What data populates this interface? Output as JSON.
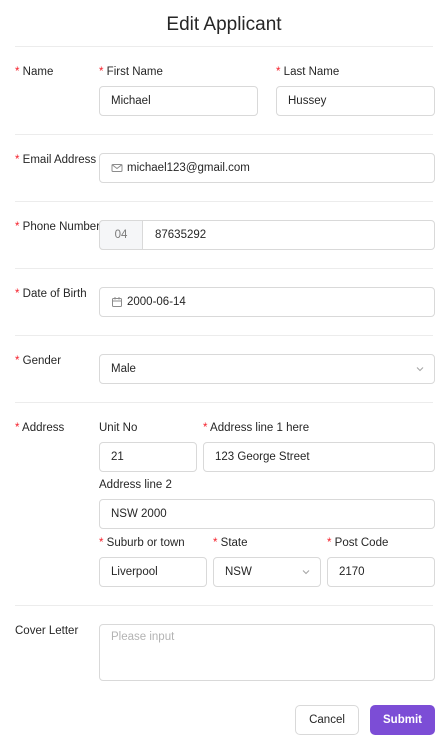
{
  "dialog": {
    "title": "Edit Applicant"
  },
  "name": {
    "label": "Name",
    "first_label": "First Name",
    "first_value": "Michael",
    "last_label": "Last Name",
    "last_value": "Hussey"
  },
  "email": {
    "label": "Email Address",
    "value": "michael123@gmail.com",
    "icon": "mail-icon"
  },
  "phone": {
    "label": "Phone Number",
    "prefix": "04",
    "value": "87635292"
  },
  "dob": {
    "label": "Date of Birth",
    "value": "2000-06-14",
    "icon": "calendar-icon"
  },
  "gender": {
    "label": "Gender",
    "value": "Male"
  },
  "address": {
    "label": "Address",
    "unit_label": "Unit No",
    "unit_value": "21",
    "line1_label": "Address line 1 here",
    "line1_value": "123 George Street",
    "line2_label": "Address line 2",
    "line2_value": "NSW 2000",
    "suburb_label": "Suburb or town",
    "suburb_value": "Liverpool",
    "state_label": "State",
    "state_value": "NSW",
    "postcode_label": "Post Code",
    "postcode_value": "2170"
  },
  "cover_letter": {
    "label": "Cover Letter",
    "placeholder": "Please input"
  },
  "actions": {
    "cancel_label": "Cancel",
    "submit_label": "Submit"
  },
  "colors": {
    "accent": "#7c4dd6",
    "required": "#f5222d"
  }
}
